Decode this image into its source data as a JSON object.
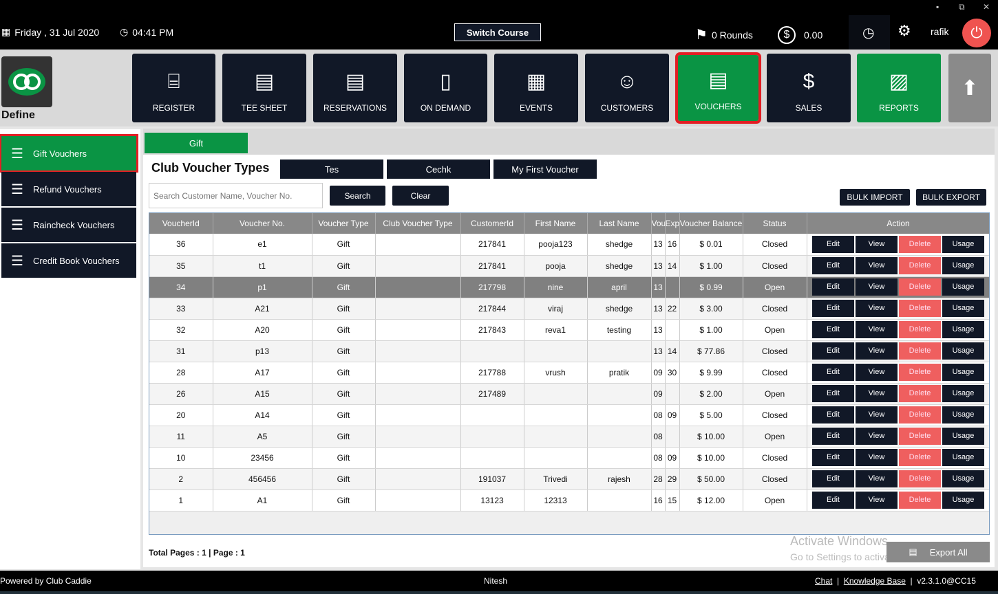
{
  "topbar": {
    "date": "Friday ,  31 Jul 2020",
    "time": "04:41 PM",
    "switch_course": "Switch Course",
    "rounds": "0 Rounds",
    "balance": "0.00",
    "user": "rafik"
  },
  "nav": {
    "brand": "Define",
    "tiles": [
      {
        "label": "REGISTER",
        "icon": "barcode-scanner-icon",
        "glyph": "⌸"
      },
      {
        "label": "TEE SHEET",
        "icon": "calendar-list-icon",
        "glyph": "▤"
      },
      {
        "label": "RESERVATIONS",
        "icon": "calendar-list-icon",
        "glyph": "▤"
      },
      {
        "label": "ON DEMAND",
        "icon": "mobile-icon",
        "glyph": "▯"
      },
      {
        "label": "EVENTS",
        "icon": "calendar-edit-icon",
        "glyph": "▦"
      },
      {
        "label": "CUSTOMERS",
        "icon": "users-icon",
        "glyph": "☺"
      },
      {
        "label": "VOUCHERS",
        "icon": "voucher-icon",
        "glyph": "▤"
      },
      {
        "label": "SALES",
        "icon": "money-stack-icon",
        "glyph": "$"
      },
      {
        "label": "REPORTS",
        "icon": "report-icon",
        "glyph": "▨"
      }
    ]
  },
  "sidebar": {
    "items": [
      {
        "label": "Gift Vouchers"
      },
      {
        "label": "Refund Vouchers"
      },
      {
        "label": "Raincheck Vouchers"
      },
      {
        "label": "Credit Book Vouchers"
      }
    ]
  },
  "main": {
    "tab": "Gift",
    "title": "Club Voucher Types",
    "type_buttons": [
      "Tes",
      "Cechk",
      "My First Voucher"
    ],
    "search_placeholder": "Search Customer Name, Voucher No.",
    "search": "Search",
    "clear": "Clear",
    "bulk_import": "BULK IMPORT",
    "bulk_export": "BULK EXPORT",
    "columns": [
      "VoucherId",
      "Voucher No.",
      "Voucher Type",
      "Club Voucher Type",
      "CustomerId",
      "First Name",
      "Last Name",
      "Vou",
      "Exp",
      "Voucher Balance",
      "Status",
      "Action"
    ],
    "actions": [
      "Edit",
      "View",
      "Delete",
      "Usage"
    ],
    "rows": [
      [
        "36",
        "e1",
        "Gift",
        "",
        "217841",
        "pooja123",
        "shedge",
        "13",
        "16",
        "$ 0.01",
        "Closed"
      ],
      [
        "35",
        "t1",
        "Gift",
        "",
        "217841",
        "pooja",
        "shedge",
        "13",
        "14",
        "$ 1.00",
        "Closed"
      ],
      [
        "34",
        "p1",
        "Gift",
        "",
        "217798",
        "nine",
        "april",
        "13",
        "",
        "$ 0.99",
        "Open"
      ],
      [
        "33",
        "A21",
        "Gift",
        "",
        "217844",
        "viraj",
        "shedge",
        "13",
        "22",
        "$ 3.00",
        "Closed"
      ],
      [
        "32",
        "A20",
        "Gift",
        "",
        "217843",
        "reva1",
        "testing",
        "13",
        "",
        "$ 1.00",
        "Open"
      ],
      [
        "31",
        "p13",
        "Gift",
        "",
        "",
        "",
        "",
        "13",
        "14",
        "$ 77.86",
        "Closed"
      ],
      [
        "28",
        "A17",
        "Gift",
        "",
        "217788",
        "vrush",
        "pratik",
        "09",
        "30",
        "$ 9.99",
        "Closed"
      ],
      [
        "26",
        "A15",
        "Gift",
        "",
        "217489",
        "",
        "",
        "09",
        "",
        "$ 2.00",
        "Open"
      ],
      [
        "20",
        "A14",
        "Gift",
        "",
        "",
        "",
        "",
        "08",
        "09",
        "$ 5.00",
        "Closed"
      ],
      [
        "11",
        "A5",
        "Gift",
        "",
        "",
        "",
        "",
        "08",
        "",
        "$ 10.00",
        "Open"
      ],
      [
        "10",
        "23456",
        "Gift",
        "",
        "",
        "",
        "",
        "08",
        "09",
        "$ 10.00",
        "Closed"
      ],
      [
        "2",
        "456456",
        "Gift",
        "",
        "191037",
        "Trivedi",
        "rajesh",
        "28",
        "29",
        "$ 50.00",
        "Closed"
      ],
      [
        "1",
        "A1",
        "Gift",
        "",
        "13123",
        "12313",
        "",
        "16",
        "15",
        "$ 12.00",
        "Open"
      ]
    ],
    "selected_voucher_id": "34",
    "totals": "Total Pages : 1 | Page : 1",
    "export_all": "Export All",
    "watermark_title": "Activate Windows",
    "watermark_sub": "Go to Settings to activate Windows."
  },
  "footer": {
    "powered": "Powered by Club Caddie",
    "user": "Nitesh",
    "chat": "Chat",
    "kb": "Knowledge Base",
    "version": "v2.3.1.0@CC15"
  },
  "colors": {
    "green": "#0a9444",
    "navy": "#111827",
    "highlight": "#e31e24",
    "delete": "#ef5f5f"
  }
}
